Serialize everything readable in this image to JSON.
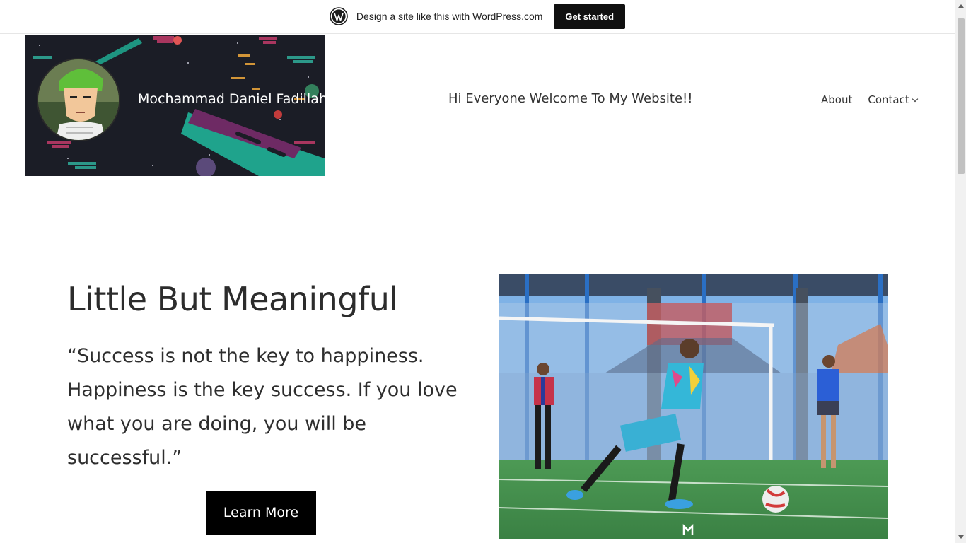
{
  "wp_banner": {
    "text": "Design a site like this with WordPress.com",
    "button_label": "Get started"
  },
  "site": {
    "name": "Mochammad Daniel Fadillah",
    "tagline": "Hi Everyone Welcome To My Website!!"
  },
  "nav": {
    "items": [
      {
        "label": "About"
      },
      {
        "label": "Contact"
      }
    ]
  },
  "hero": {
    "title": "Little But Meaningful",
    "quote": "“Success is not the key to happiness. Happiness is the key success. If you love what you are doing, you will be successful.”",
    "button_label": "Learn More"
  },
  "colors": {
    "wp_button_bg": "#101010",
    "banner_bg": "#1b1d26",
    "primary_button_bg": "#000000",
    "text": "#2b2b2b"
  }
}
